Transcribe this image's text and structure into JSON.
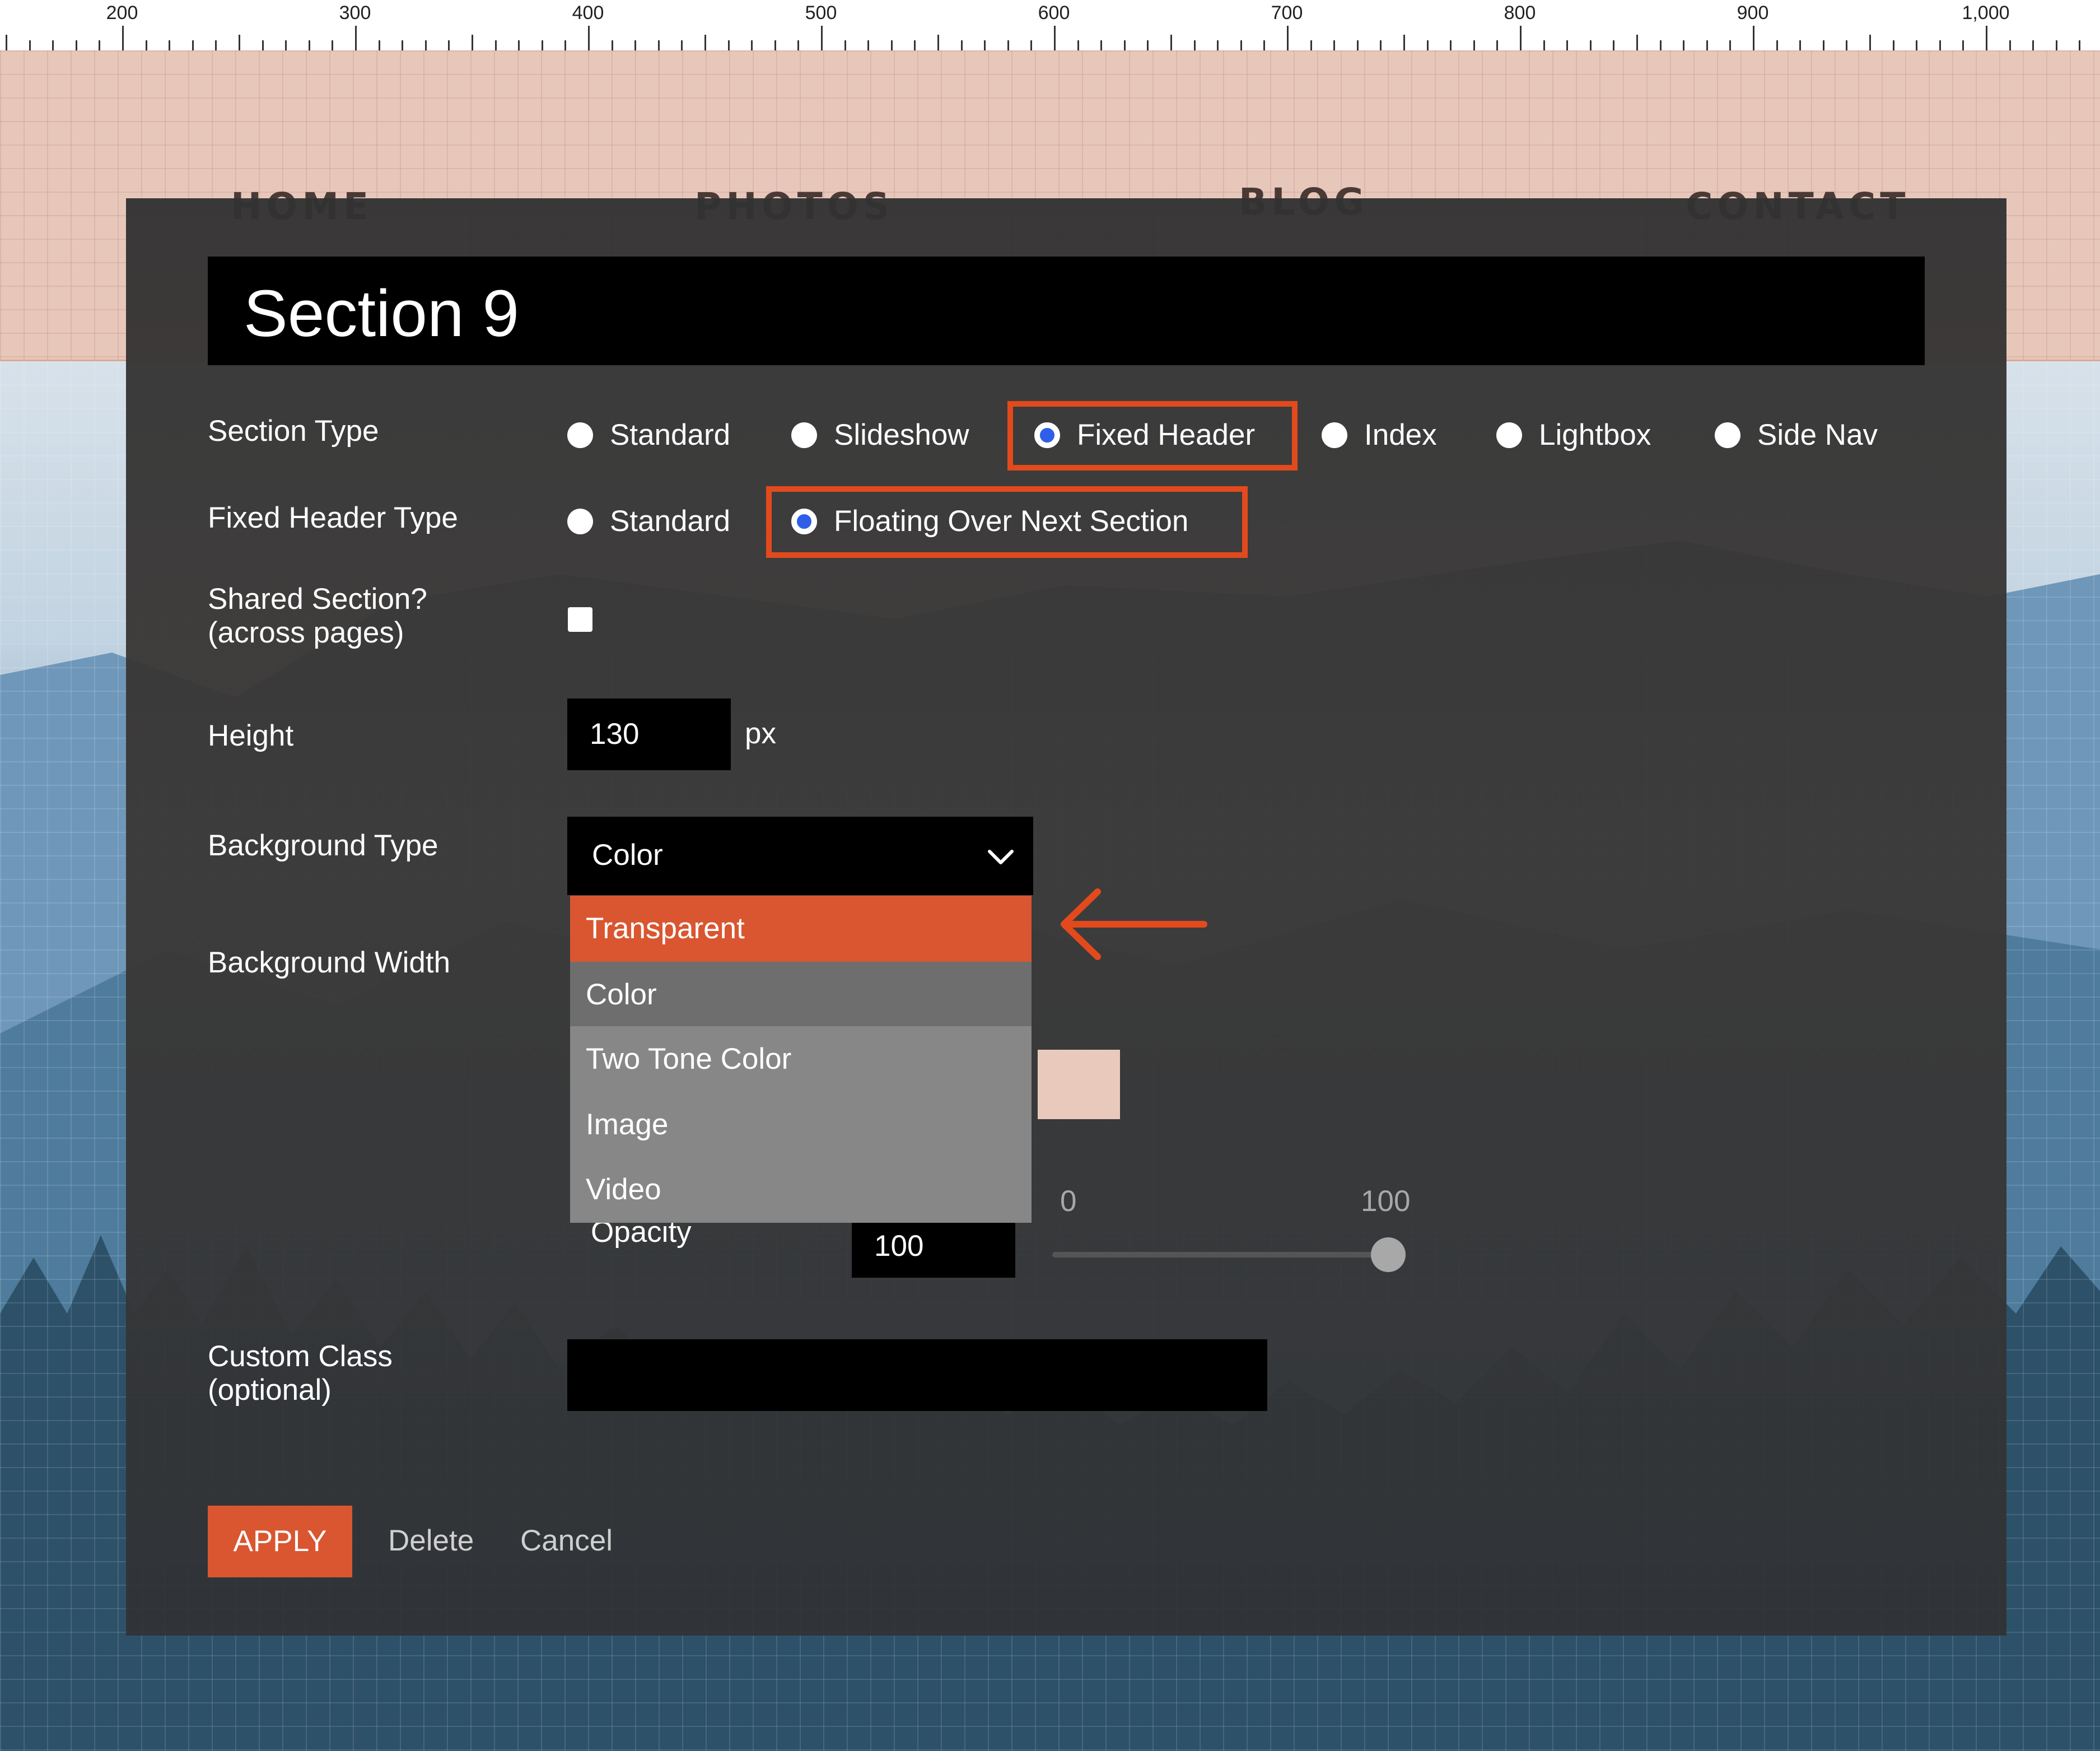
{
  "ruler": {
    "labels": [
      "200",
      "300",
      "400",
      "500",
      "600",
      "700",
      "800",
      "900",
      "1,000"
    ]
  },
  "nav": {
    "items": [
      "HOME",
      "PHOTOS",
      "BLOG",
      "CONTACT"
    ]
  },
  "dialog": {
    "title": "Section 9",
    "section_type": {
      "label": "Section Type",
      "options": [
        "Standard",
        "Slideshow",
        "Fixed Header",
        "Index",
        "Lightbox",
        "Side Nav"
      ],
      "selected": "Fixed Header"
    },
    "fixed_header_type": {
      "label": "Fixed Header Type",
      "options": [
        "Standard",
        "Floating Over Next Section"
      ],
      "selected": "Floating Over Next Section"
    },
    "shared_section": {
      "label_line1": "Shared Section?",
      "label_line2": "(across pages)",
      "checked": false
    },
    "height": {
      "label": "Height",
      "value": "130",
      "unit": "px"
    },
    "background_type": {
      "label": "Background Type",
      "value": "Color",
      "options": [
        "Transparent",
        "Color",
        "Two Tone Color",
        "Image",
        "Video"
      ],
      "highlighted": "Transparent"
    },
    "background_width": {
      "label": "Background Width"
    },
    "background_color": {
      "value": "#e9c9bc"
    },
    "opacity": {
      "label": "Opacity",
      "value": "100",
      "slider_min": "0",
      "slider_max": "100",
      "level": 1.0
    },
    "custom_class": {
      "label_line1": "Custom Class",
      "label_line2": "(optional)",
      "value": ""
    },
    "buttons": {
      "apply": "APPLY",
      "delete": "Delete",
      "cancel": "Cancel"
    }
  },
  "colors": {
    "accent": "#e24a1d",
    "apply": "#d95630",
    "radio_checked": "#2f5ee8"
  }
}
